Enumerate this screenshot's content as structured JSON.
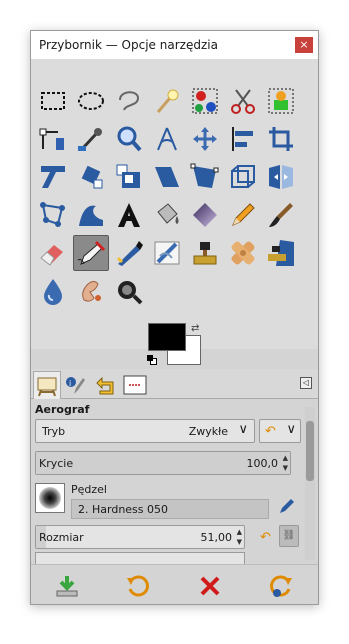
{
  "window": {
    "title": "Przybornik — Opcje narzędzia",
    "close_label": "×"
  },
  "toolbox": {
    "tools": [
      {
        "name": "rect-select-icon"
      },
      {
        "name": "ellipse-select-icon"
      },
      {
        "name": "free-select-icon"
      },
      {
        "name": "fuzzy-select-icon"
      },
      {
        "name": "by-color-select-icon"
      },
      {
        "name": "scissors-select-icon"
      },
      {
        "name": "foreground-select-icon"
      },
      {
        "name": "paths-icon"
      },
      {
        "name": "color-picker-icon"
      },
      {
        "name": "zoom-icon"
      },
      {
        "name": "measure-icon"
      },
      {
        "name": "move-icon"
      },
      {
        "name": "align-icon"
      },
      {
        "name": "crop-icon"
      },
      {
        "name": "unified-transform-icon"
      },
      {
        "name": "rotate-icon"
      },
      {
        "name": "scale-icon"
      },
      {
        "name": "shear-icon"
      },
      {
        "name": "perspective-icon"
      },
      {
        "name": "3d-transform-icon"
      },
      {
        "name": "flip-icon"
      },
      {
        "name": "cage-transform-icon"
      },
      {
        "name": "warp-transform-icon"
      },
      {
        "name": "text-icon"
      },
      {
        "name": "bucket-fill-icon"
      },
      {
        "name": "gradient-icon"
      },
      {
        "name": "pencil-icon"
      },
      {
        "name": "paintbrush-icon"
      },
      {
        "name": "eraser-icon"
      },
      {
        "name": "airbrush-icon"
      },
      {
        "name": "ink-icon"
      },
      {
        "name": "mypaint-brush-icon"
      },
      {
        "name": "clone-icon"
      },
      {
        "name": "heal-icon"
      },
      {
        "name": "perspective-clone-icon"
      },
      {
        "name": "blur-sharpen-icon"
      },
      {
        "name": "smudge-icon"
      },
      {
        "name": "dodge-burn-icon"
      }
    ],
    "active_tool": "airbrush-icon",
    "colors": {
      "foreground": "#000000",
      "background": "#ffffff",
      "swap_glyph": "⇄"
    }
  },
  "tabs": [
    {
      "name": "tool-options-tab-icon"
    },
    {
      "name": "device-status-tab-icon"
    },
    {
      "name": "undo-history-tab-icon"
    },
    {
      "name": "images-tab-icon"
    }
  ],
  "tab_menu_glyph": "◁",
  "options": {
    "tool_name": "Aerograf",
    "mode": {
      "label": "Tryb",
      "value": "Zwykłe",
      "chevron": "∨"
    },
    "mode_extra_chevron": "∨",
    "opacity": {
      "label": "Krycie",
      "value": "100,0",
      "fraction": 1.0
    },
    "brush": {
      "label": "Pędzel",
      "value": "2. Hardness 050"
    },
    "size": {
      "label": "Rozmiar",
      "value": "51,00",
      "fraction": 0.05
    }
  },
  "bottom_buttons": [
    {
      "name": "save-options-button"
    },
    {
      "name": "restore-options-button"
    },
    {
      "name": "delete-options-button"
    },
    {
      "name": "reset-options-button"
    }
  ],
  "accent_colors": {
    "selected_tool": "#8a8a8a",
    "close": "#c8413a",
    "reset": "#e08a00",
    "delete": "#d11a1a",
    "save": "#3aa640"
  }
}
